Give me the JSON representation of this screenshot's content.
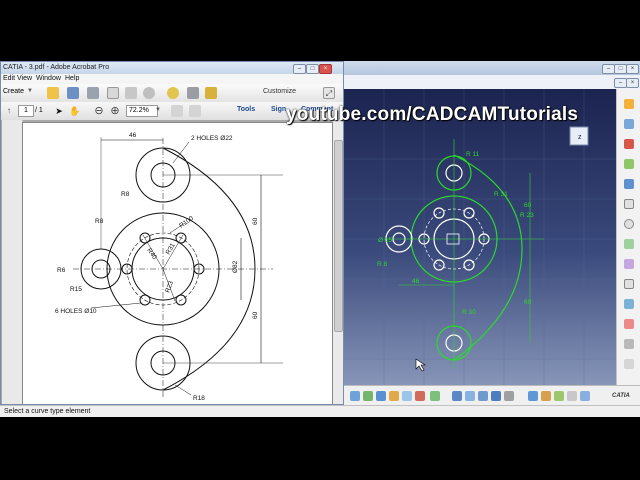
{
  "acrobat": {
    "title": "CATIA - 3.pdf - Adobe Acrobat Pro",
    "menu": [
      "Edit",
      "View",
      "Window",
      "Help"
    ],
    "create_label": "Create",
    "customize_label": "Customize",
    "page_number": "1",
    "page_total": "/ 1",
    "zoom": "72.2%",
    "tabs": [
      "Tools",
      "Sign",
      "Comment"
    ]
  },
  "drawing_labels": {
    "d46": "46",
    "holes22": "2 HOLES Ø22",
    "r8a": "R8",
    "r100": "R100",
    "r8b": "R8",
    "r40": "R40",
    "r31": "R31",
    "r23": "R23",
    "r6": "R6",
    "r15": "R15",
    "d60a": "60",
    "d82": "Ø82",
    "d60b": "60",
    "holes10": "6 HOLES Ø10",
    "r18": "R18"
  },
  "catia_labels": {
    "r11": "R 11",
    "r31": "R 31",
    "r23": "R 23",
    "d60a": "60",
    "d60b": "60",
    "r8": "R 8",
    "d46": "46",
    "d15": "Ø 15",
    "r30": "R 30"
  },
  "watermark": "youtube.com/CADCAMTutorials",
  "status": "Select a curve type element",
  "catia_logo": "CATIA",
  "colors": {
    "sketch_green": "#2bd92b",
    "viewport_top": "#1c2450",
    "viewport_bottom": "#8795b8"
  }
}
